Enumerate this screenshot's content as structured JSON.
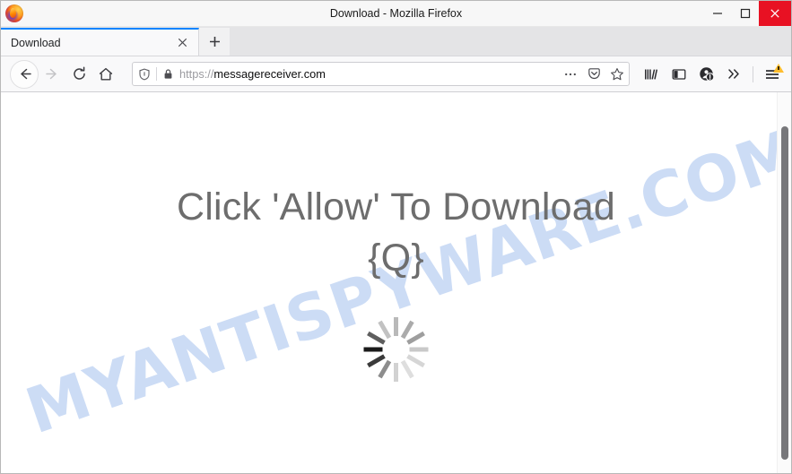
{
  "window": {
    "title": "Download - Mozilla Firefox",
    "logo_icon": "firefox-logo",
    "controls": {
      "minimize_icon": "minimize-icon",
      "maximize_icon": "maximize-icon",
      "close_icon": "close-icon"
    }
  },
  "tabs": {
    "items": [
      {
        "label": "Download",
        "active": true,
        "close_icon": "close-icon"
      }
    ],
    "new_tab_icon": "plus-icon",
    "accent_color": "#0a84ff"
  },
  "toolbar": {
    "back_icon": "back-arrow-icon",
    "forward_icon": "forward-arrow-icon",
    "reload_icon": "reload-icon",
    "home_icon": "home-icon",
    "library_icon": "library-icon",
    "sidebar_icon": "sidebar-icon",
    "account_icon": "account-warning-icon",
    "overflow_icon": "double-chevron-icon",
    "menu_icon": "hamburger-menu-icon",
    "menu_badge_icon": "warning-triangle-icon"
  },
  "urlbar": {
    "shield_icon": "shield-icon",
    "lock_icon": "padlock-icon",
    "scheme": "https://",
    "host": "messagereceiver.com",
    "full_url": "https://messagereceiver.com",
    "page_actions_icon": "ellipsis-icon",
    "pocket_icon": "pocket-icon",
    "bookmark_icon": "star-icon"
  },
  "page": {
    "heading_line1": "Click 'Allow' To Download",
    "heading_line2": "{Q}",
    "heading_color": "#6d6d6d",
    "spinner_icon": "loading-spinner-icon",
    "watermark_text": "MYANTISPYWARE.COM",
    "watermark_color": "#ccdcf5",
    "background_color": "#ffffff"
  },
  "scrollbar": {
    "vertical_thumb": "scrollbar-thumb"
  }
}
